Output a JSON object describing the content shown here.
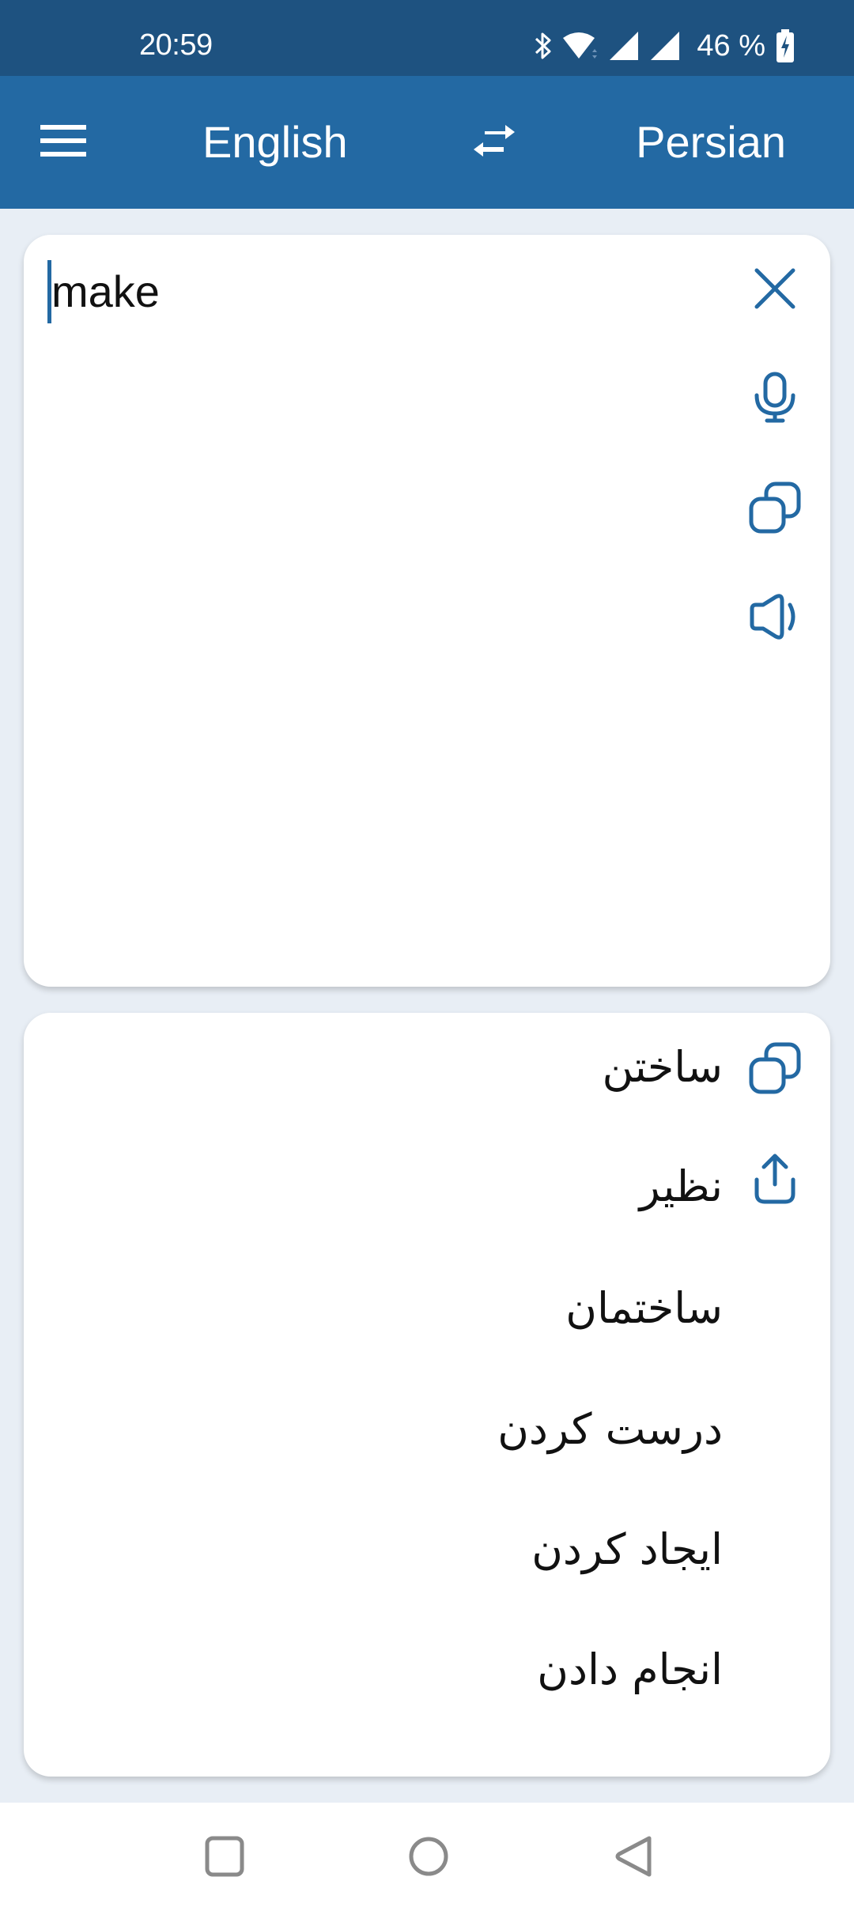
{
  "status_bar": {
    "time": "20:59",
    "battery_percent": "46 %",
    "icons": [
      "bluetooth-icon",
      "wifi-icon",
      "signal-icon",
      "signal-icon",
      "battery-charging-icon"
    ]
  },
  "app_bar": {
    "menu_icon": "menu-icon",
    "source_language": "English",
    "swap_icon": "swap-icon",
    "target_language": "Persian"
  },
  "input_card": {
    "text": "make",
    "actions": [
      "close-icon",
      "microphone-icon",
      "copy-icon",
      "speaker-icon"
    ]
  },
  "output_card": {
    "actions": [
      "copy-icon",
      "share-icon"
    ],
    "translations": [
      "ساختن",
      "نظیر",
      "ساختمان",
      "درست کردن",
      "ایجاد کردن",
      "انجام دادن"
    ]
  },
  "nav_bar": {
    "buttons": [
      "recents-icon",
      "home-icon",
      "back-icon"
    ]
  },
  "colors": {
    "status_bar": "#1e5280",
    "app_bar": "#2369a3",
    "accent": "#2369a3",
    "background": "#e8eef5",
    "card": "#ffffff",
    "nav_icon": "#8a8a8a"
  }
}
